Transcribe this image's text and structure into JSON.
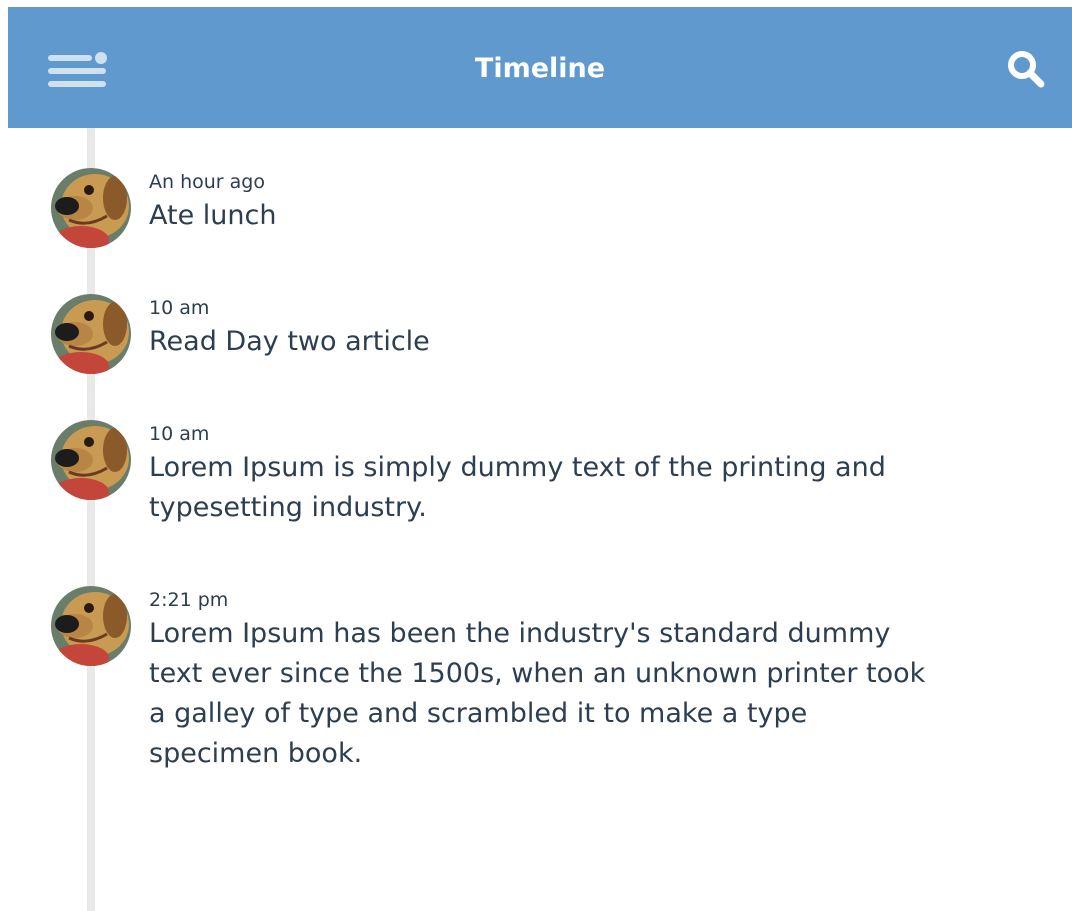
{
  "header": {
    "title": "Timeline",
    "menu_icon": "menu-icon",
    "search_icon": "search-icon",
    "background_color": "#5f99cd"
  },
  "timeline": {
    "line_color": "#e9e9e9",
    "entries": [
      {
        "time": "An hour ago",
        "text": "Ate lunch",
        "avatar_icon": "dog-avatar"
      },
      {
        "time": "10 am",
        "text": "Read Day two article",
        "avatar_icon": "dog-avatar"
      },
      {
        "time": "10 am",
        "text": "Lorem Ipsum is simply dummy text of the printing and typesetting industry.",
        "avatar_icon": "dog-avatar"
      },
      {
        "time": "2:21 pm",
        "text": "Lorem Ipsum has been the industry's standard dummy text ever since the 1500s, when an unknown printer took a galley of type and scrambled it to make a type specimen book.",
        "avatar_icon": "dog-avatar"
      }
    ]
  }
}
